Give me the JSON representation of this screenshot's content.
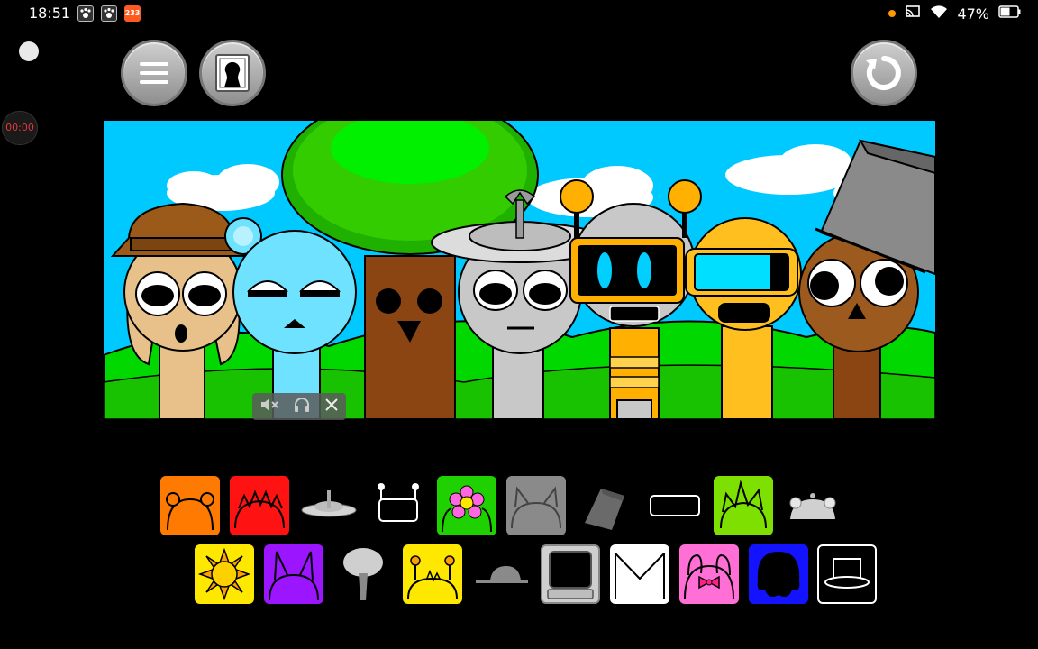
{
  "status_bar": {
    "time": "18:51",
    "battery_text": "47%",
    "app_icons": [
      "paw-app-icon",
      "paw-app-icon-2",
      "233-app-icon"
    ],
    "app_badge_text": "233",
    "status_icons": [
      "notification-dot-icon",
      "cast-icon",
      "wifi-icon",
      "battery-icon"
    ]
  },
  "recorder": {
    "timer": "00:00"
  },
  "toolbar": {
    "menu_icon": "hamburger-menu-icon",
    "profile_icon": "portrait-frame-icon",
    "reset_icon": "reset-icon"
  },
  "stage": {
    "characters": [
      "brown-hat-character",
      "blue-character",
      "tree-character",
      "grey-antenna-hat-character",
      "robot-character",
      "yellow-visor-character",
      "bucket-character"
    ]
  },
  "mini_overlay": {
    "icons": [
      "mute-icon",
      "headphones-icon",
      "close-icon"
    ]
  },
  "palette": {
    "row1": [
      "orange-horns",
      "red-spikes",
      "grey-plate-hat",
      "black-antenna-box",
      "green-flower",
      "grey-cat-ears",
      "grey-bucket",
      "black-visor",
      "lime-spikes",
      "grey-dome-lid"
    ],
    "row2": [
      "yellow-sun",
      "purple-ears",
      "grey-mushroom",
      "yellow-antenna-hat",
      "grey-cap",
      "computer-monitor",
      "white-envelope",
      "pink-bow",
      "blue-blob",
      "black-top-hat"
    ]
  },
  "colors": {
    "sky": "#00c9ff",
    "grass": "#00d800",
    "orange": "#ff7a00",
    "red": "#ff1212",
    "green": "#1fd100",
    "lime": "#7ee000",
    "yellow": "#ffe800",
    "purple": "#9b16ff",
    "pink": "#ff6fd6",
    "blue": "#1313ff"
  }
}
